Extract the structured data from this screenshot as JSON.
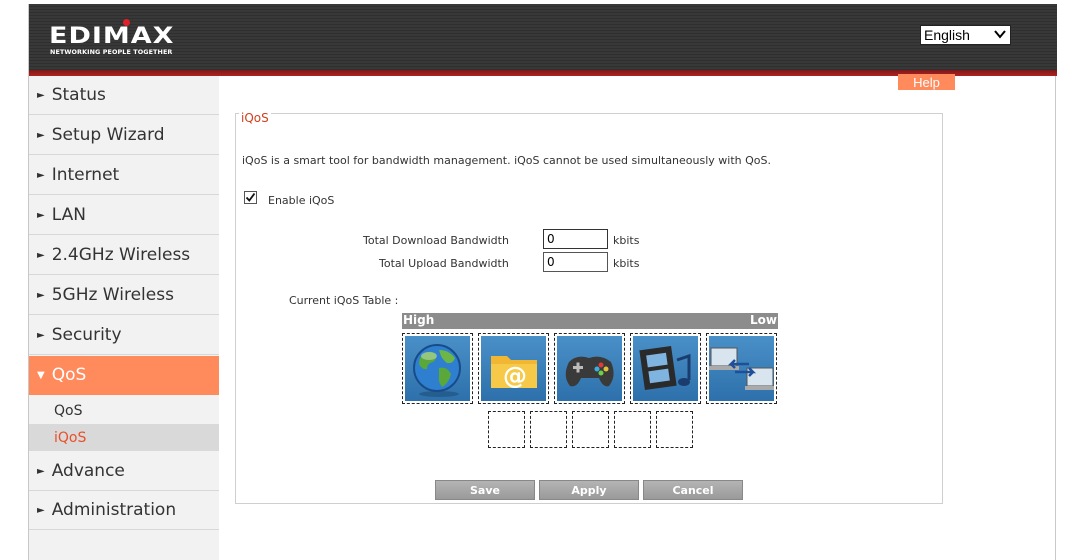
{
  "header": {
    "brand": "EDIMAX",
    "tagline": "NETWORKING PEOPLE TOGETHER",
    "language": {
      "selected": "English"
    }
  },
  "sidebar": {
    "items": [
      {
        "label": "Status"
      },
      {
        "label": "Setup Wizard"
      },
      {
        "label": "Internet"
      },
      {
        "label": "LAN"
      },
      {
        "label": "2.4GHz Wireless"
      },
      {
        "label": "5GHz Wireless"
      },
      {
        "label": "Security"
      },
      {
        "label": "QoS"
      },
      {
        "label": "Advance"
      },
      {
        "label": "Administration"
      }
    ],
    "qos_sub": [
      {
        "label": "QoS"
      },
      {
        "label": "iQoS"
      }
    ],
    "active_item": "QoS",
    "active_sub": "iQoS"
  },
  "help_label": "Help",
  "main": {
    "title": "iQoS",
    "description": "iQoS is a smart tool for bandwidth management. iQoS cannot be used simultaneously with QoS.",
    "enable_label": "Enable  iQoS",
    "enable_checked": true,
    "download_label": "Total Download Bandwidth",
    "download_value": "0",
    "upload_label": "Total Upload Bandwidth",
    "upload_value": "0",
    "unit": "kbits",
    "table_label": "Current iQoS Table :",
    "high_label": "High",
    "low_label": "Low",
    "apps": [
      {
        "icon": "globe-icon"
      },
      {
        "icon": "email-folder-icon"
      },
      {
        "icon": "gamepad-icon"
      },
      {
        "icon": "media-film-icon"
      },
      {
        "icon": "file-transfer-icon"
      }
    ],
    "buttons": {
      "save": "Save",
      "apply": "Apply",
      "cancel": "Cancel"
    }
  },
  "colors": {
    "accent": "#ff8a5c",
    "title": "#d0401e",
    "tile": "#3a80bc"
  }
}
